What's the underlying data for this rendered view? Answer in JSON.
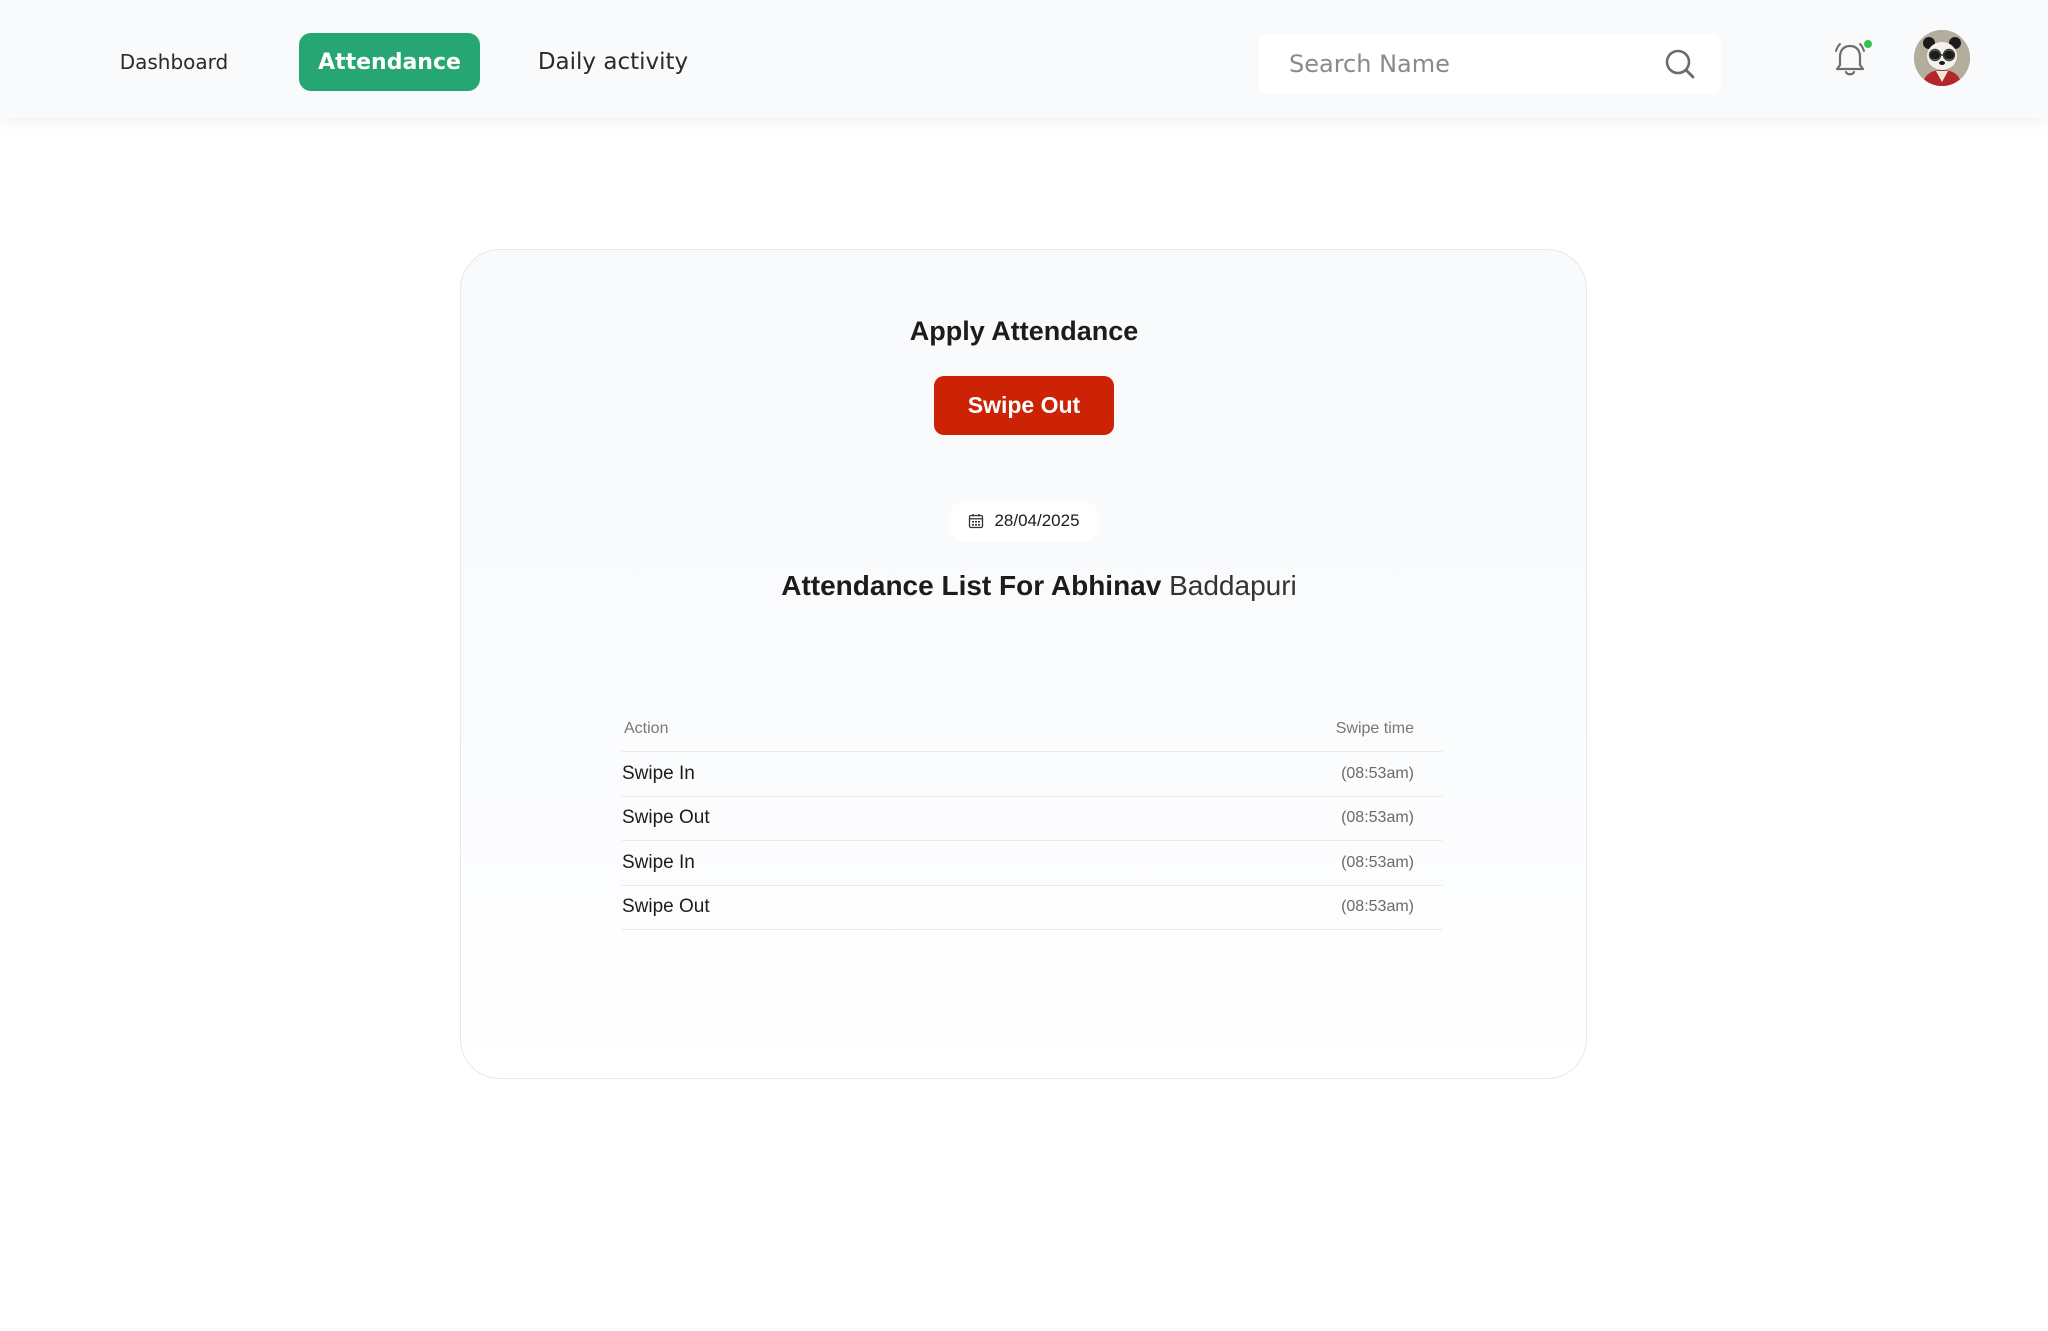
{
  "nav": {
    "dashboard_label": "Dashboard",
    "attendance_label": "Attendance",
    "daily_activity_label": "Daily activity"
  },
  "search": {
    "placeholder": "Search Name",
    "value": ""
  },
  "header_icons": [
    "bell-icon",
    "avatar"
  ],
  "colors": {
    "active_nav": "#26a673",
    "swipe_button": "#cc2205",
    "notification_dot": "#36c24b"
  },
  "card": {
    "title": "Apply Attendance",
    "swipe_button_label": "Swipe Out",
    "date": "28/04/2025",
    "list_title_bold": "Attendance List For Abhinav",
    "list_title_name": "Baddapuri"
  },
  "table": {
    "headers": {
      "action": "Action",
      "swipe_time": "Swipe time"
    },
    "rows": [
      {
        "action": "Swipe In",
        "time": "(08:53am)"
      },
      {
        "action": "Swipe Out",
        "time": "(08:53am)"
      },
      {
        "action": "Swipe In",
        "time": "(08:53am)"
      },
      {
        "action": "Swipe Out",
        "time": "(08:53am)"
      }
    ]
  }
}
